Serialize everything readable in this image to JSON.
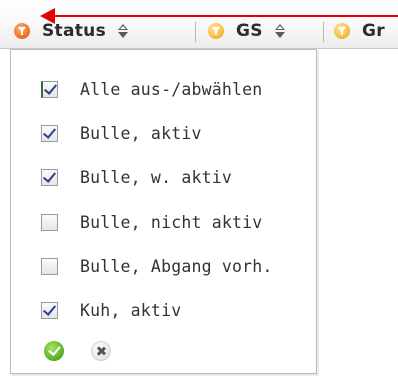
{
  "header": {
    "columns": [
      {
        "label": "Status",
        "filter_state": "active"
      },
      {
        "label": "GS",
        "filter_state": "inactive"
      },
      {
        "label": "Gr",
        "filter_state": "inactive"
      }
    ],
    "annotation_color": "#e60000"
  },
  "filter_panel": {
    "options": [
      {
        "label": "Alle aus-/abwählen",
        "checked": true
      },
      {
        "label": "Bulle, aktiv",
        "checked": true
      },
      {
        "label": "Bulle, w. aktiv",
        "checked": true
      },
      {
        "label": "Bulle, nicht aktiv",
        "checked": false
      },
      {
        "label": "Bulle, Abgang vorh.",
        "checked": false
      },
      {
        "label": "Kuh, aktiv",
        "checked": true
      }
    ],
    "actions": {
      "apply_icon": "check-circle-icon",
      "cancel_icon": "close-circle-icon"
    }
  },
  "colors": {
    "filter_active": "#f07a2a",
    "filter_inactive": "#f7c04a",
    "apply": "#5fb52a",
    "checkmark": "#2b3f8f"
  }
}
